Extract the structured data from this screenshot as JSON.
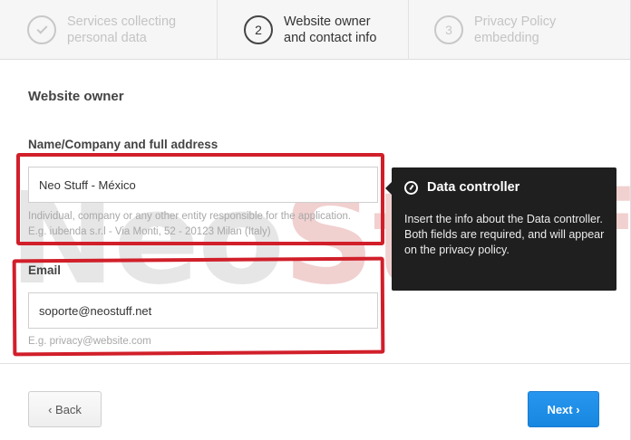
{
  "steps": [
    {
      "number": "",
      "label": "Services collecting\npersonal data",
      "state": "done"
    },
    {
      "number": "2",
      "label": "Website owner\nand contact info",
      "state": "active"
    },
    {
      "number": "3",
      "label": "Privacy Policy\nembedding",
      "state": "upcoming"
    }
  ],
  "section_title": "Website owner",
  "name_field": {
    "label": "Name/Company and full address",
    "value": "Neo Stuff - México",
    "hint_line1": "Individual, company or any other entity responsible for the application.",
    "hint_line2": "E.g. iubenda s.r.l - Via Monti, 52 - 20123 Milan (Italy)"
  },
  "email_field": {
    "label": "Email",
    "value": "soporte@neostuff.net",
    "hint": "E.g. privacy@website.com"
  },
  "tooltip": {
    "title": "Data controller",
    "body": "Insert the info about the Data controller. Both fields are required, and will appear on the privacy policy."
  },
  "watermark": {
    "part1": "Neo",
    "part2": "Stuff"
  },
  "buttons": {
    "back": "‹ Back",
    "next": "Next ›"
  },
  "colors": {
    "highlight": "#d11f2a",
    "primary": "#1787e0",
    "tooltip_bg": "#1f1f1f"
  }
}
